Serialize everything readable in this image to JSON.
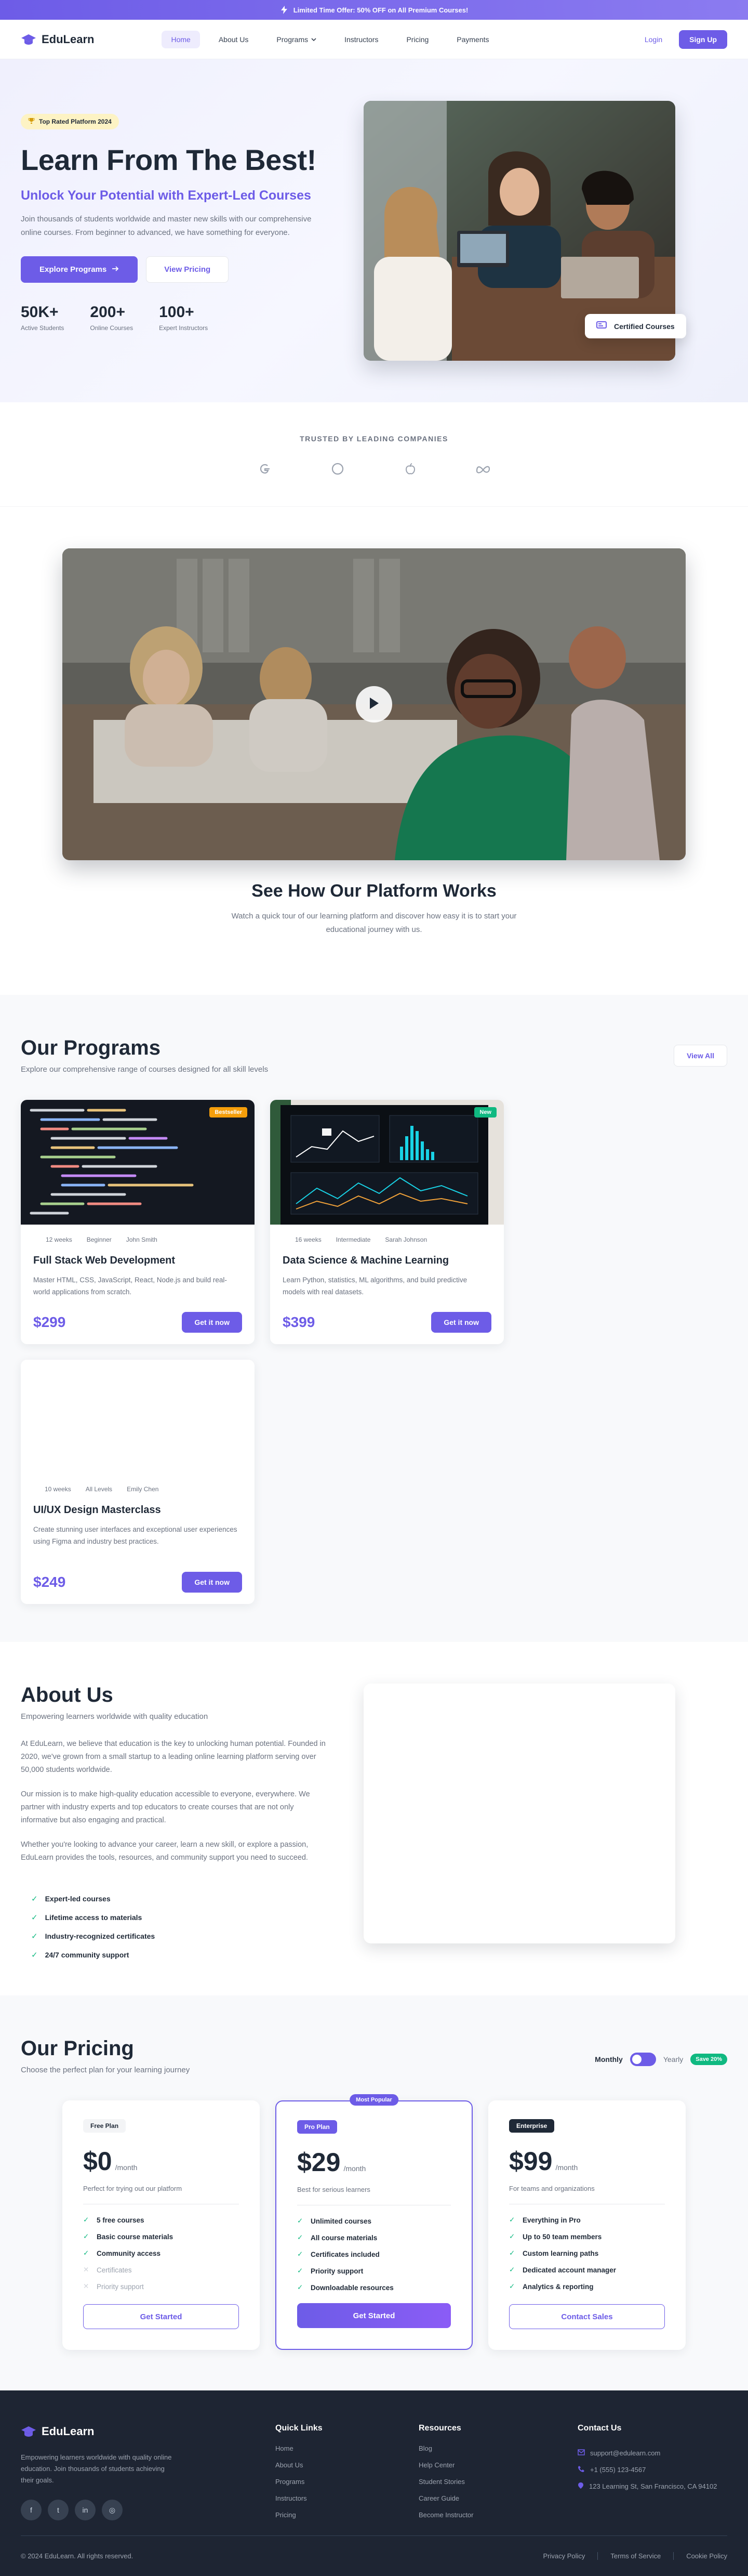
{
  "announcement": {
    "text": "Limited Time Offer: 50% OFF on All Premium Courses!",
    "icon": "bolt-icon"
  },
  "header": {
    "brand": "EduLearn",
    "nav": [
      {
        "label": "Home",
        "active": true
      },
      {
        "label": "About Us"
      },
      {
        "label": "Programs",
        "dropdown": true
      },
      {
        "label": "Instructors"
      },
      {
        "label": "Pricing"
      },
      {
        "label": "Payments"
      }
    ],
    "login": "Login",
    "signup": "Sign Up"
  },
  "hero": {
    "badge": "Top Rated Platform 2024",
    "title": "Learn From The Best!",
    "subtitle": "Unlock Your Potential with Expert-Led Courses",
    "description": "Join thousands of students worldwide and master new skills with our comprehensive online courses. From beginner to advanced, we have something for everyone.",
    "cta_primary": "Explore Programs",
    "cta_secondary": "View Pricing",
    "stats": [
      {
        "value": "50K+",
        "label": "Active Students"
      },
      {
        "value": "200+",
        "label": "Online Courses"
      },
      {
        "value": "100+",
        "label": "Expert Instructors"
      }
    ],
    "certified": "Certified Courses"
  },
  "trusted": {
    "label": "TRUSTED BY LEADING COMPANIES",
    "logos": [
      "google-icon",
      "microsoft-icon",
      "apple-icon",
      "meta-icon"
    ]
  },
  "video": {
    "title": "See How Our Platform Works",
    "description": "Watch a quick tour of our learning platform and discover how easy it is to start your educational journey with us."
  },
  "programs": {
    "title": "Our Programs",
    "subtitle": "Explore our comprehensive range of courses designed for all skill levels",
    "view_all": "View All",
    "courses": [
      {
        "tag": "Bestseller",
        "tag_color": "#f59e0b",
        "duration": "12 weeks",
        "level": "Beginner",
        "instructor": "John Smith",
        "title": "Full Stack Web Development",
        "desc": "Master HTML, CSS, JavaScript, React, Node.js and build real-world applications from scratch.",
        "price": "$299",
        "cta": "Get it now"
      },
      {
        "tag": "New",
        "tag_color": "#10b981",
        "duration": "16 weeks",
        "level": "Intermediate",
        "instructor": "Sarah Johnson",
        "title": "Data Science & Machine Learning",
        "desc": "Learn Python, statistics, ML algorithms, and build predictive models with real datasets.",
        "price": "$399",
        "cta": "Get it now"
      },
      {
        "tag": "",
        "duration": "10 weeks",
        "level": "All Levels",
        "instructor": "Emily Chen",
        "title": "UI/UX Design Masterclass",
        "desc": "Create stunning user interfaces and exceptional user experiences using Figma and industry best practices.",
        "price": "$249",
        "cta": "Get it now"
      }
    ]
  },
  "about": {
    "title": "About Us",
    "subtitle": "Empowering learners worldwide with quality education",
    "paragraphs": [
      "At EduLearn, we believe that education is the key to unlocking human potential. Founded in 2020, we've grown from a small startup to a leading online learning platform serving over 50,000 students worldwide.",
      "Our mission is to make high-quality education accessible to everyone, everywhere. We partner with industry experts and top educators to create courses that are not only informative but also engaging and practical.",
      "Whether you're looking to advance your career, learn a new skill, or explore a passion, EduLearn provides the tools, resources, and community support you need to succeed."
    ],
    "features": [
      "Expert-led courses",
      "Lifetime access to materials",
      "Industry-recognized certificates",
      "24/7 community support"
    ]
  },
  "pricing": {
    "title": "Our Pricing",
    "subtitle": "Choose the perfect plan for your learning journey",
    "monthly": "Monthly",
    "yearly": "Yearly",
    "save": "Save 20%",
    "popular_label": "Most Popular",
    "plans": [
      {
        "name": "Free Plan",
        "price": "$0",
        "period": "/month",
        "tagline": "Perfect for trying out our platform",
        "features": [
          {
            "text": "5 free courses",
            "on": true
          },
          {
            "text": "Basic course materials",
            "on": true
          },
          {
            "text": "Community access",
            "on": true
          },
          {
            "text": "Certificates",
            "on": false
          },
          {
            "text": "Priority support",
            "on": false
          }
        ],
        "cta": "Get Started"
      },
      {
        "name": "Pro Plan",
        "price": "$29",
        "period": "/month",
        "tagline": "Best for serious learners",
        "features": [
          {
            "text": "Unlimited courses",
            "on": true
          },
          {
            "text": "All course materials",
            "on": true
          },
          {
            "text": "Certificates included",
            "on": true
          },
          {
            "text": "Priority support",
            "on": true
          },
          {
            "text": "Downloadable resources",
            "on": true
          }
        ],
        "cta": "Get Started"
      },
      {
        "name": "Enterprise",
        "price": "$99",
        "period": "/month",
        "tagline": "For teams and organizations",
        "features": [
          {
            "text": "Everything in Pro",
            "on": true
          },
          {
            "text": "Up to 50 team members",
            "on": true
          },
          {
            "text": "Custom learning paths",
            "on": true
          },
          {
            "text": "Dedicated account manager",
            "on": true
          },
          {
            "text": "Analytics & reporting",
            "on": true
          }
        ],
        "cta": "Contact Sales"
      }
    ]
  },
  "footer": {
    "brand": "EduLearn",
    "about": "Empowering learners worldwide with quality online education. Join thousands of students achieving their goals.",
    "socials": [
      "facebook-icon",
      "twitter-icon",
      "linkedin-icon",
      "instagram-icon"
    ],
    "quick_links_title": "Quick Links",
    "quick_links": [
      "Home",
      "About Us",
      "Programs",
      "Instructors",
      "Pricing"
    ],
    "resources_title": "Resources",
    "resources": [
      "Blog",
      "Help Center",
      "Student Stories",
      "Career Guide",
      "Become Instructor"
    ],
    "contact_title": "Contact Us",
    "contact": [
      "support@edulearn.com",
      "+1 (555) 123-4567",
      "123 Learning St, San Francisco, CA 94102"
    ],
    "copyright": "© 2024 EduLearn. All rights reserved.",
    "legal": [
      "Privacy Policy",
      "Terms of Service",
      "Cookie Policy"
    ]
  },
  "colors": {
    "accent": "#6d5ce7",
    "success": "#10b981",
    "footer_bg": "#1e2533"
  }
}
